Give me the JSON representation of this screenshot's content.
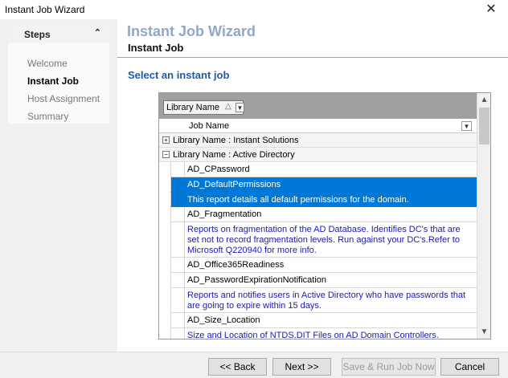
{
  "window": {
    "title": "Instant Job Wizard"
  },
  "steps": {
    "header": "Steps",
    "items": [
      "Welcome",
      "Instant Job",
      "Host Assignment",
      "Summary"
    ],
    "active_index": 1
  },
  "header": {
    "title": "Instant Job Wizard",
    "subtitle": "Instant Job"
  },
  "section_title": "Select an instant job",
  "grid": {
    "group_by_chip": "Library Name",
    "column_header": "Job Name",
    "groups": [
      {
        "label": "Library Name :  Instant Solutions",
        "expanded": false
      },
      {
        "label": "Library Name : Active Directory",
        "expanded": true
      }
    ],
    "rows": [
      {
        "name": "AD_CPassword"
      },
      {
        "name": "AD_DefaultPermissions",
        "desc": "This report details all default permissions for the domain.",
        "selected": true
      },
      {
        "name": "AD_Fragmentation",
        "desc": "Reports on fragmentation of the AD Database.  Identifies DC's that are set not to record fragmentation levels.  Run against your DC's.Refer to Microsoft Q220940 for more info."
      },
      {
        "name": "AD_Office365Readiness"
      },
      {
        "name": "AD_PasswordExpirationNotification",
        "desc": "Reports and notifies users in Active Directory who have passwords that are going to expire within 15 days."
      },
      {
        "name": "AD_Size_Location",
        "desc": "Size and Location of NTDS.DIT Files on AD Domain Controllers."
      }
    ]
  },
  "footer": {
    "back": "<< Back",
    "next": "Next >>",
    "save_run": "Save & Run Job Now",
    "cancel": "Cancel"
  },
  "colors": {
    "selection": "#0078d7",
    "title_accent": "#8fa8c8",
    "section_title": "#1a5ca8",
    "desc_text": "#1a1ab4"
  }
}
